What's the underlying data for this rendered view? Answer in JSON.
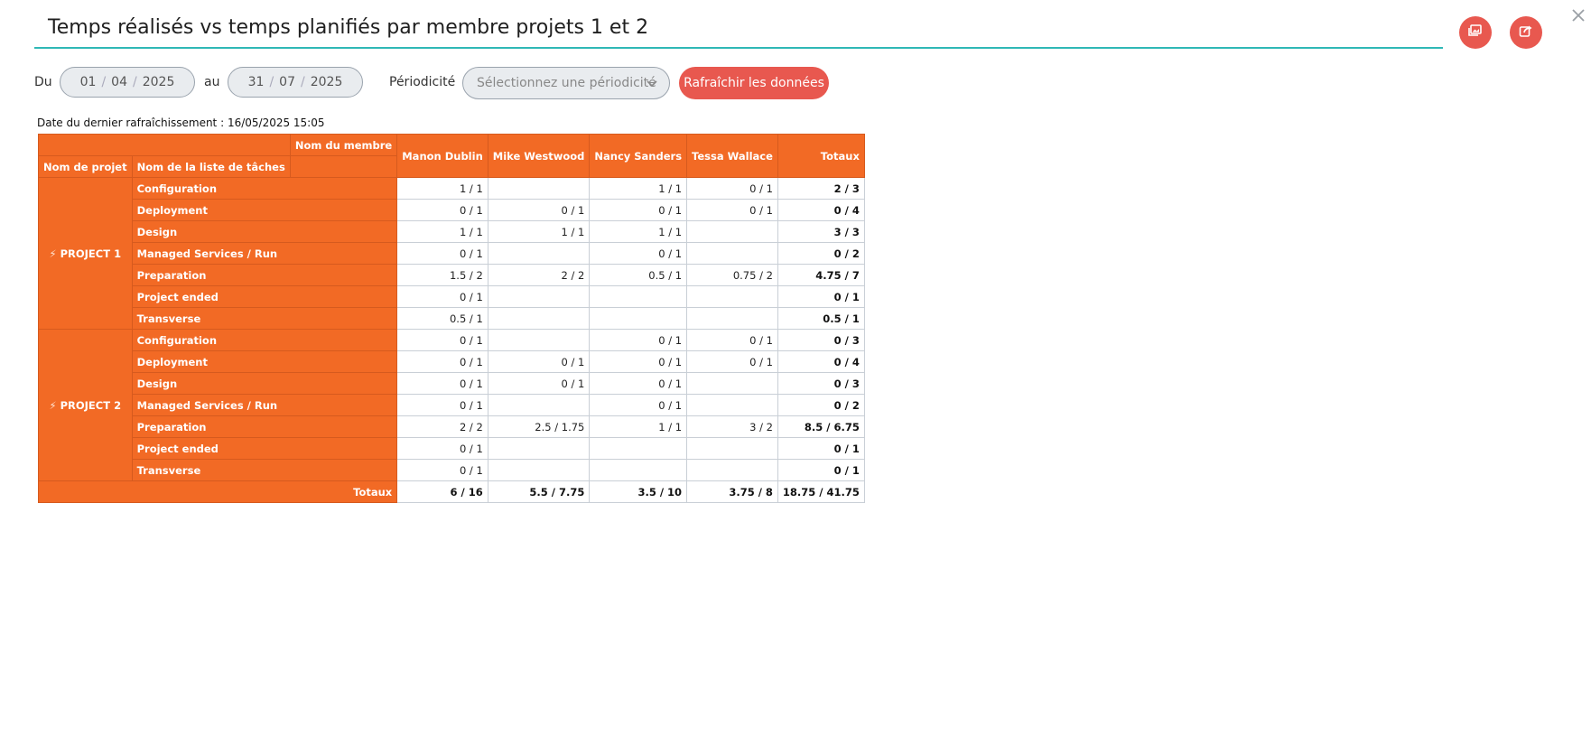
{
  "header": {
    "title": "Temps réalisés vs temps planifiés par membre projets 1 et 2"
  },
  "filters": {
    "from_label": "Du",
    "from_date": {
      "day": "01",
      "month": "04",
      "year": "2025"
    },
    "to_label": "au",
    "to_date": {
      "day": "31",
      "month": "07",
      "year": "2025"
    },
    "periodicity_label": "Périodicité",
    "periodicity_placeholder": "Sélectionnez une périodicité",
    "refresh_label": "Rafraîchir les données"
  },
  "refresh_info": "Date du dernier rafraîchissement : 16/05/2025 15:05",
  "table": {
    "member_header": "Nom du membre",
    "project_header": "Nom de projet",
    "tasklist_header": "Nom de la liste de tâches",
    "members": [
      "Manon Dublin",
      "Mike Westwood",
      "Nancy Sanders",
      "Tessa Wallace"
    ],
    "totals_header": "Totaux",
    "projects": [
      {
        "name": "PROJECT 1",
        "rows": [
          {
            "task": "Configuration",
            "values": [
              "1 / 1",
              "",
              "1 / 1",
              "0 / 1"
            ],
            "total": "2 / 3"
          },
          {
            "task": "Deployment",
            "values": [
              "0 / 1",
              "0 / 1",
              "0 / 1",
              "0 / 1"
            ],
            "total": "0 / 4"
          },
          {
            "task": "Design",
            "values": [
              "1 / 1",
              "1 / 1",
              "1 / 1",
              ""
            ],
            "total": "3 / 3"
          },
          {
            "task": "Managed Services / Run",
            "values": [
              "0 / 1",
              "",
              "0 / 1",
              ""
            ],
            "total": "0 / 2"
          },
          {
            "task": "Preparation",
            "values": [
              "1.5 / 2",
              "2 / 2",
              "0.5 / 1",
              "0.75 / 2"
            ],
            "total": "4.75 / 7"
          },
          {
            "task": "Project ended",
            "values": [
              "0 / 1",
              "",
              "",
              ""
            ],
            "total": "0 / 1"
          },
          {
            "task": "Transverse",
            "values": [
              "0.5 / 1",
              "",
              "",
              ""
            ],
            "total": "0.5 / 1"
          }
        ]
      },
      {
        "name": "PROJECT 2",
        "rows": [
          {
            "task": "Configuration",
            "values": [
              "0 / 1",
              "",
              "0 / 1",
              "0 / 1"
            ],
            "total": "0 / 3"
          },
          {
            "task": "Deployment",
            "values": [
              "0 / 1",
              "0 / 1",
              "0 / 1",
              "0 / 1"
            ],
            "total": "0 / 4"
          },
          {
            "task": "Design",
            "values": [
              "0 / 1",
              "0 / 1",
              "0 / 1",
              ""
            ],
            "total": "0 / 3"
          },
          {
            "task": "Managed Services / Run",
            "values": [
              "0 / 1",
              "",
              "0 / 1",
              ""
            ],
            "total": "0 / 2"
          },
          {
            "task": "Preparation",
            "values": [
              "2 / 2",
              "2.5 / 1.75",
              "1 / 1",
              "3 / 2"
            ],
            "total": "8.5 / 6.75"
          },
          {
            "task": "Project ended",
            "values": [
              "0 / 1",
              "",
              "",
              ""
            ],
            "total": "0 / 1"
          },
          {
            "task": "Transverse",
            "values": [
              "0 / 1",
              "",
              "",
              ""
            ],
            "total": "0 / 1"
          }
        ]
      }
    ],
    "grand_totals_label": "Totaux",
    "grand_totals": [
      "6 / 16",
      "5.5 / 7.75",
      "3.5 / 10",
      "3.75 / 8"
    ],
    "grand_total": "18.75 / 41.75"
  },
  "icons": {
    "export_image": "image-export-icon",
    "share": "share-export-icon",
    "close": "close-icon",
    "project": "lightning-icon",
    "dropdown": "chevron-down-icon"
  },
  "colors": {
    "accent": "#e8584f",
    "header_orange": "#f26a25",
    "title_underline": "#2fb8b6"
  }
}
